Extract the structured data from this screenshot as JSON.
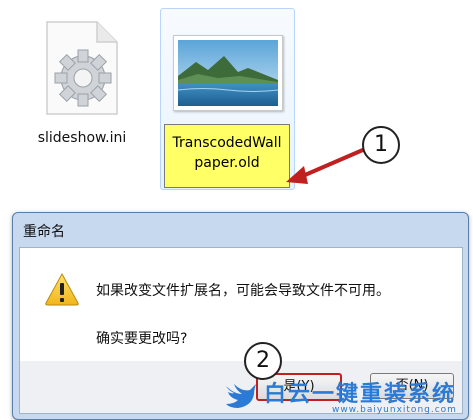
{
  "explorer": {
    "files": [
      {
        "name": "slideshow.ini",
        "icon": "settings-file-icon"
      },
      {
        "rename_line1": "TranscodedWall",
        "rename_line2": "paper.old",
        "icon": "image-thumbnail-icon"
      }
    ]
  },
  "callouts": {
    "one": "1",
    "two": "2"
  },
  "dialog": {
    "title": "重命名",
    "message": "如果改变文件扩展名，可能会导致文件不可用。",
    "question": "确实要更改吗?",
    "yes_label": "是(Y)",
    "no_label": "否(N)"
  },
  "watermark": {
    "brand": "白云一键重装系统",
    "url": "www.baiyunxitong.com"
  },
  "colors": {
    "accent": "#c02020",
    "selection": "#ffff66",
    "dialog_frame": "#c7d9ee",
    "watermark": "#2a7ad6"
  }
}
